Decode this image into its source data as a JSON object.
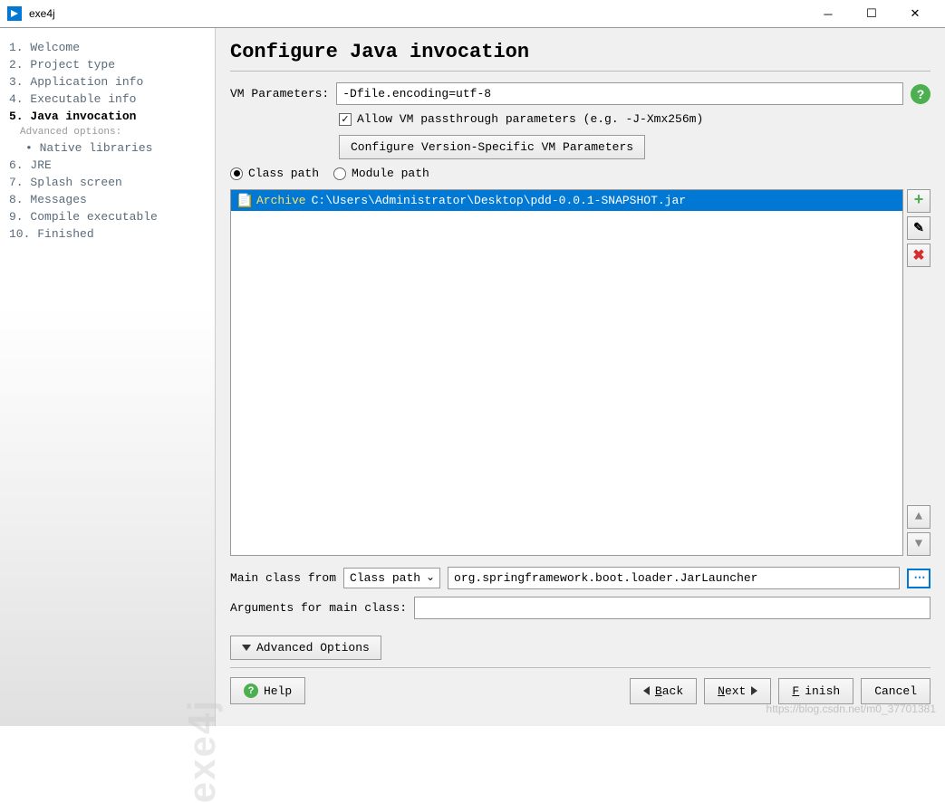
{
  "window": {
    "title": "exe4j"
  },
  "sidebar": {
    "items": [
      {
        "num": "1.",
        "label": "Welcome"
      },
      {
        "num": "2.",
        "label": "Project type"
      },
      {
        "num": "3.",
        "label": "Application info"
      },
      {
        "num": "4.",
        "label": "Executable info"
      },
      {
        "num": "5.",
        "label": "Java invocation"
      },
      {
        "num": "6.",
        "label": "JRE"
      },
      {
        "num": "7.",
        "label": "Splash screen"
      },
      {
        "num": "8.",
        "label": "Messages"
      },
      {
        "num": "9.",
        "label": "Compile executable"
      },
      {
        "num": "10.",
        "label": "Finished"
      }
    ],
    "advanced_label": "Advanced options:",
    "subitems": [
      {
        "label": "Native libraries"
      }
    ],
    "watermark": "exe4j"
  },
  "content": {
    "title": "Configure Java invocation",
    "vm_params_label": "VM Parameters:",
    "vm_params_value": "-Dfile.encoding=utf-8",
    "allow_passthrough_label": "Allow VM passthrough parameters (e.g. -J-Xmx256m)",
    "configure_version_btn": "Configure Version-Specific VM Parameters",
    "class_path_label": "Class path",
    "module_path_label": "Module path",
    "archive_label": "Archive",
    "archive_path": "C:\\Users\\Administrator\\Desktop\\pdd-0.0.1-SNAPSHOT.jar",
    "main_class_label": "Main class from",
    "main_class_select": "Class path",
    "main_class_value": "org.springframework.boot.loader.JarLauncher",
    "arguments_label": "Arguments for main class:",
    "arguments_value": "",
    "advanced_options_btn": "Advanced Options"
  },
  "footer": {
    "help": "Help",
    "back": "Back",
    "next": "Next",
    "finish": "Finish",
    "cancel": "Cancel"
  },
  "watermark_url": "https://blog.csdn.net/m0_37701381"
}
